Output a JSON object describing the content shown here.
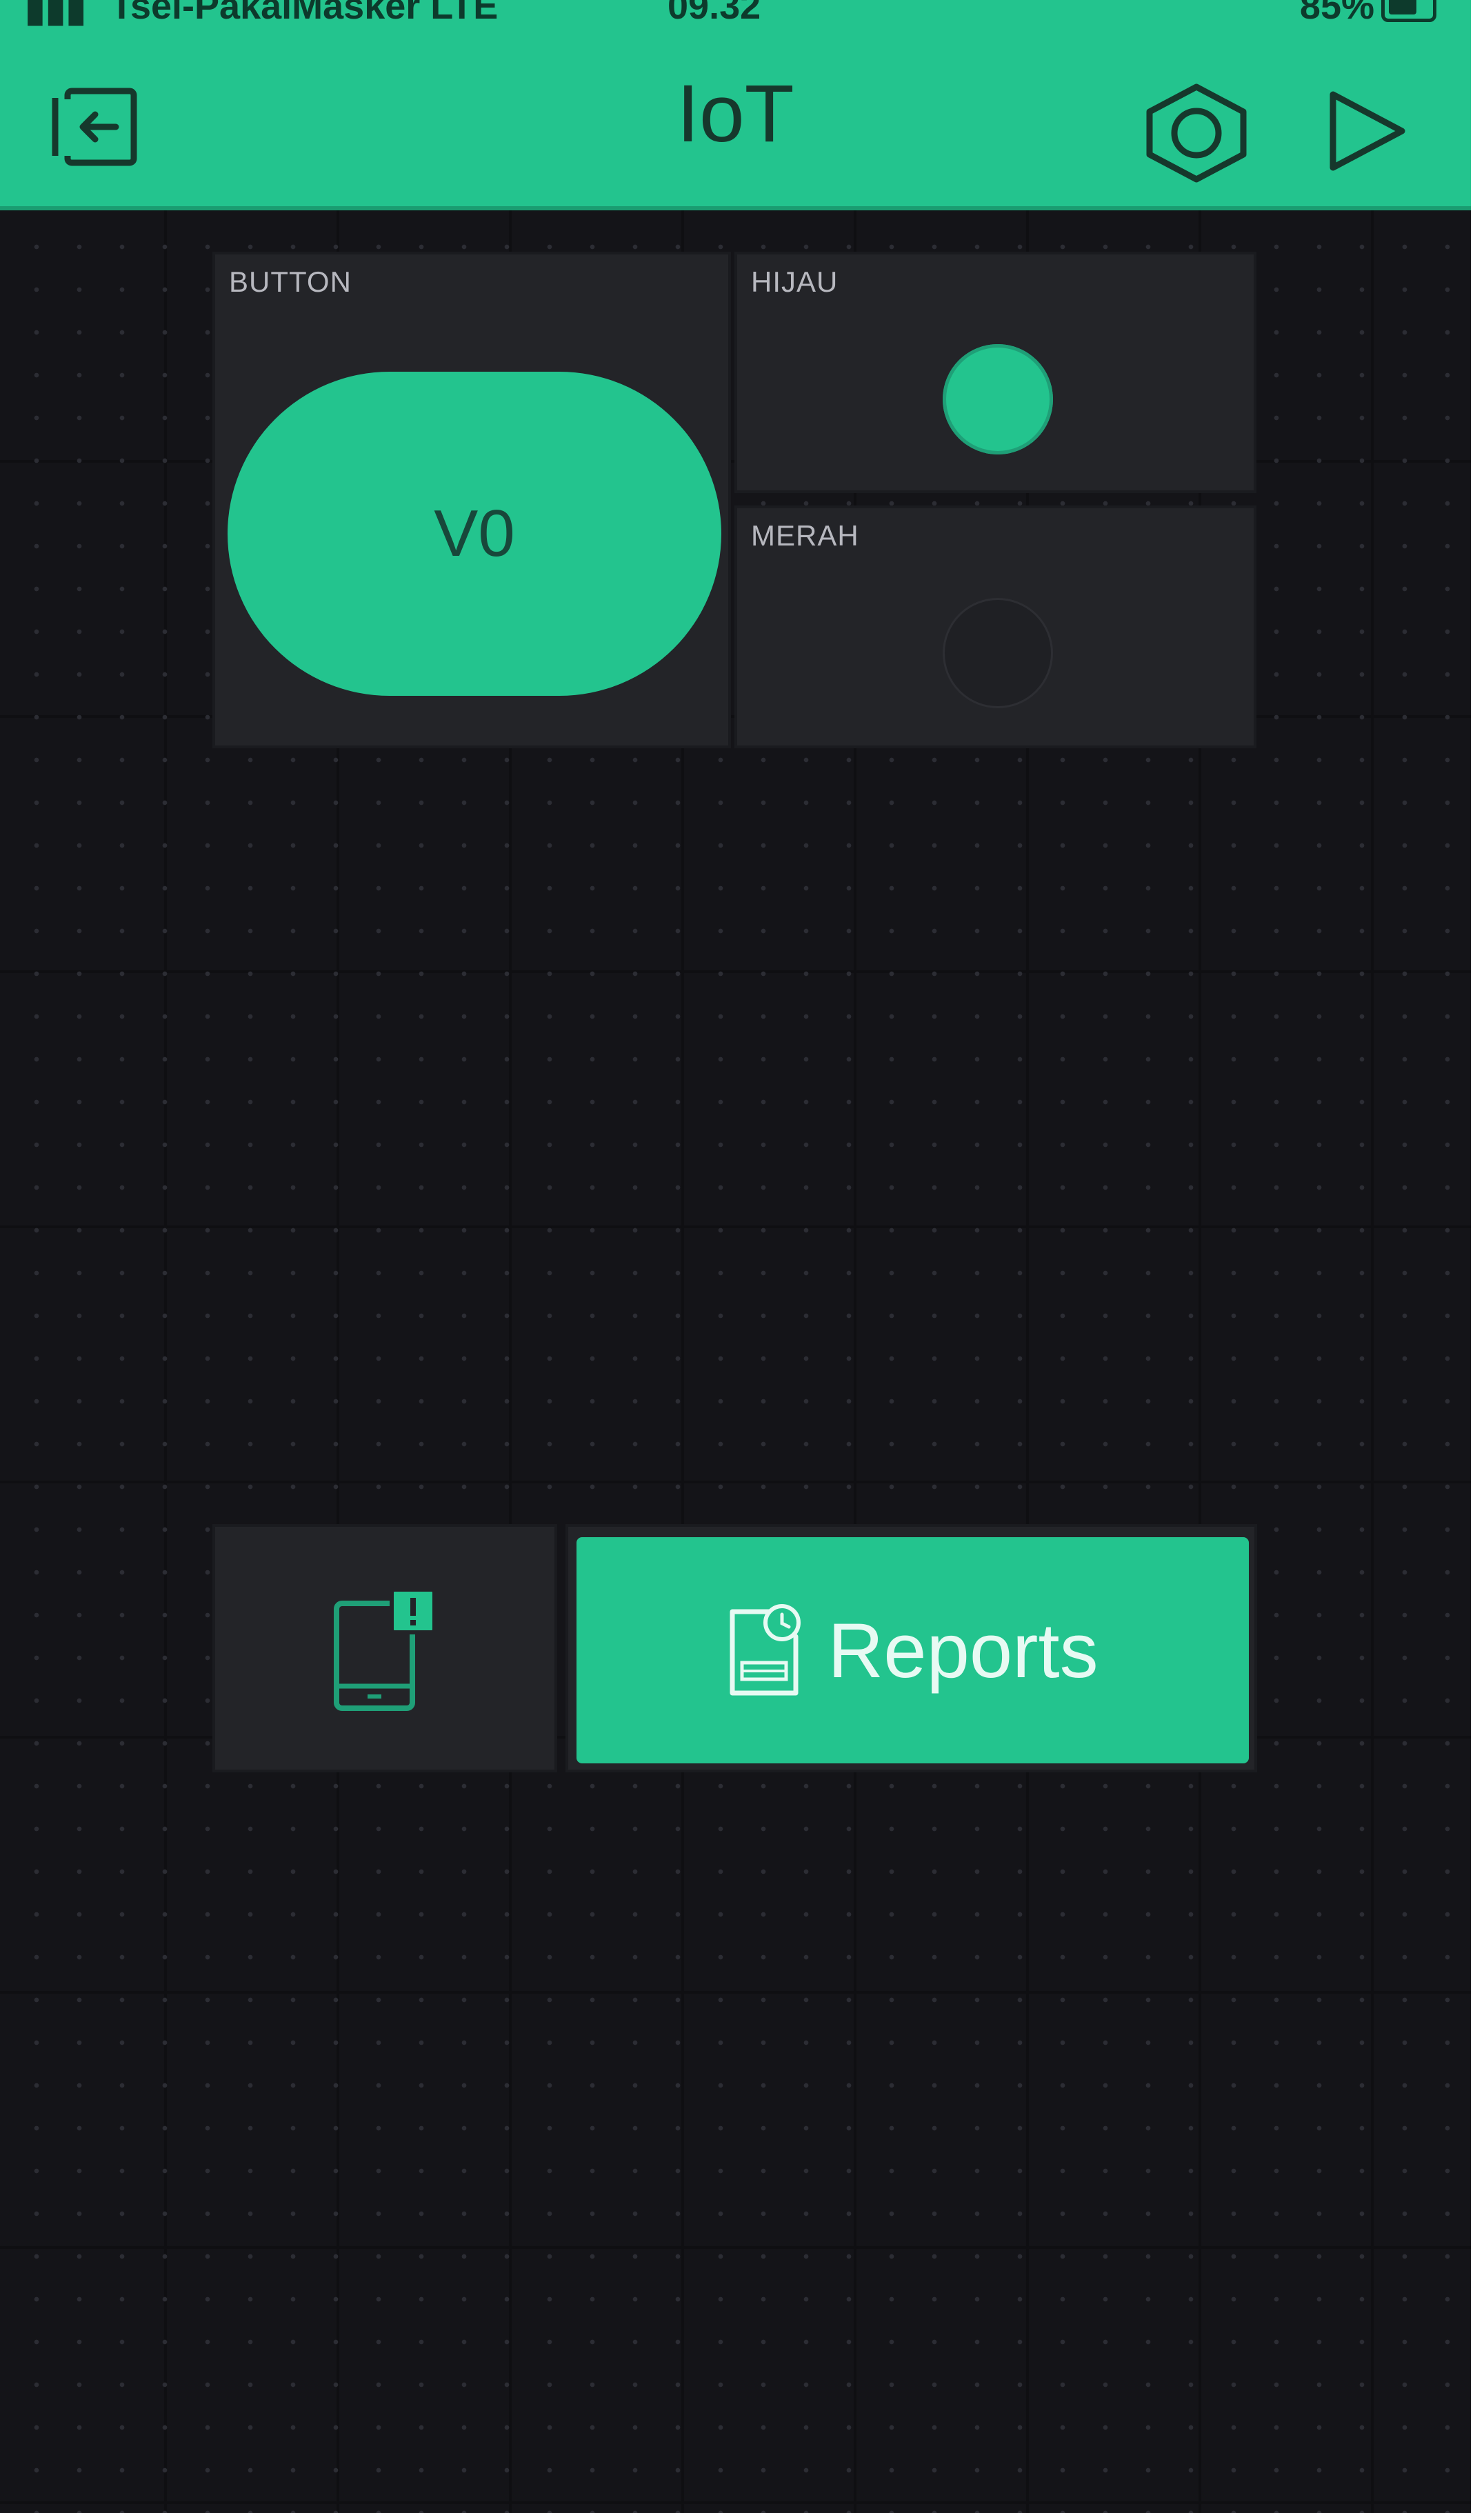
{
  "status_bar": {
    "carrier": "Tsel-PakaiMasker LTE",
    "time": "09.32",
    "battery": "85%"
  },
  "header": {
    "title": "IoT",
    "icons": [
      "exit-icon",
      "settings-icon",
      "play-icon"
    ]
  },
  "widgets": {
    "button": {
      "label": "BUTTON",
      "pin": "V0"
    },
    "led_hijau": {
      "label": "HIJAU",
      "state": "on",
      "color": "#23c48e"
    },
    "led_merah": {
      "label": "MERAH",
      "state": "off"
    },
    "notification": {
      "icon": "phone-notification-icon"
    },
    "reports": {
      "label": "Reports",
      "icon": "report-icon"
    }
  },
  "colors": {
    "accent": "#23c48e",
    "background": "#141418",
    "widget": "#232428"
  }
}
